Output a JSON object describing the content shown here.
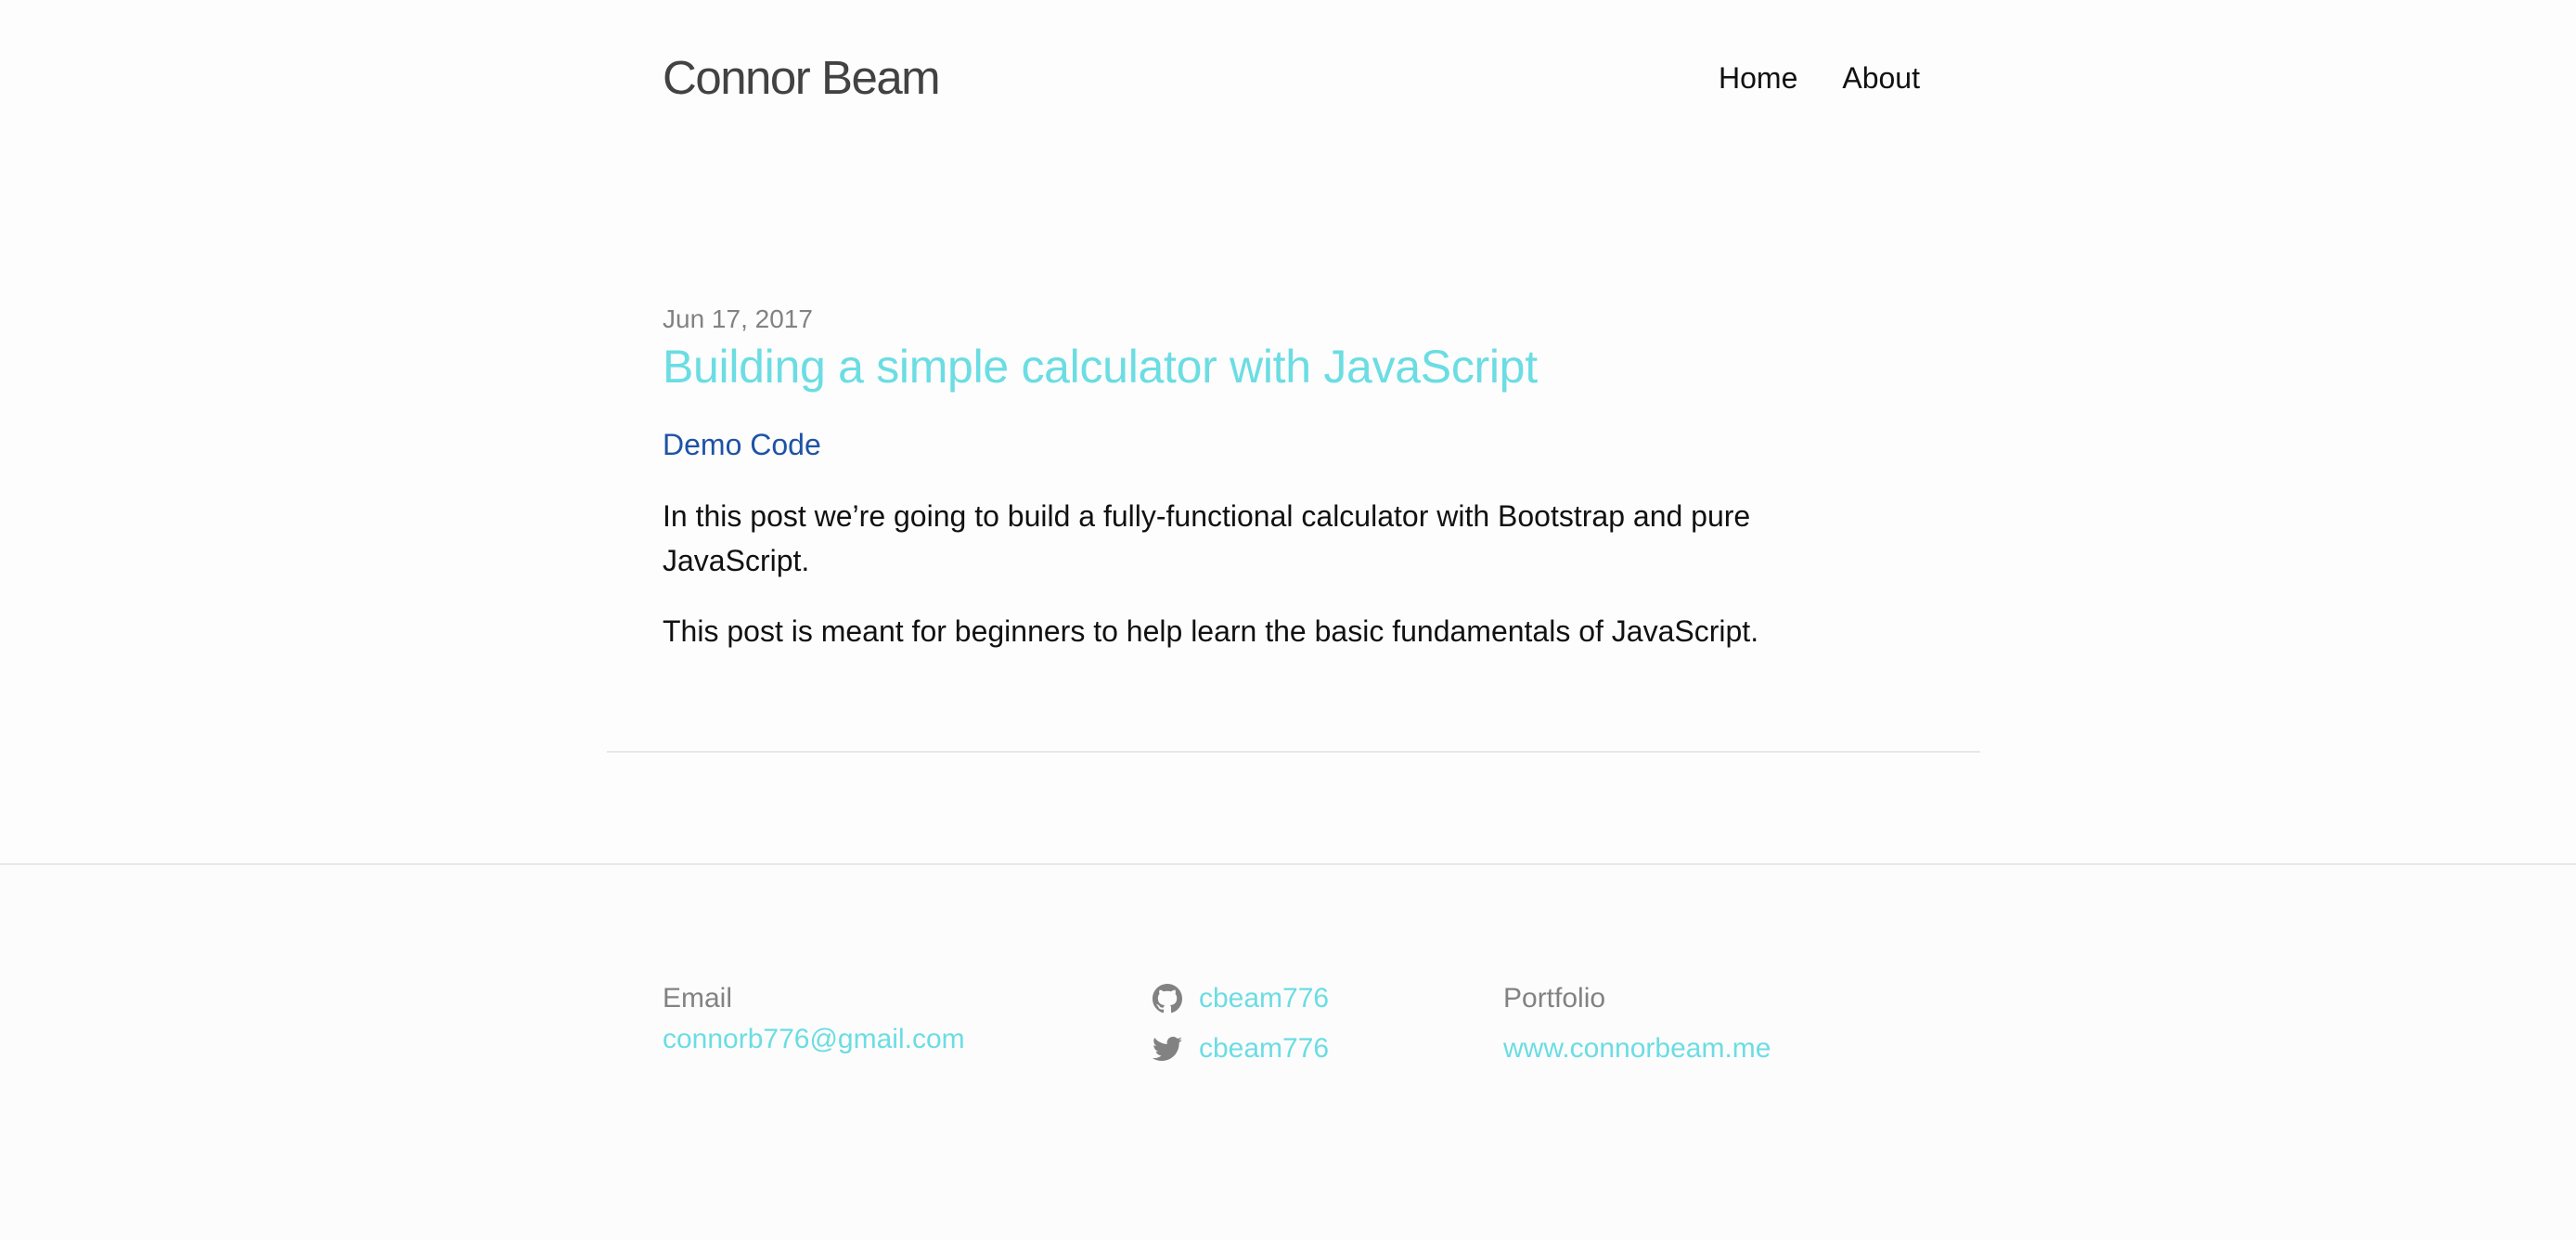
{
  "header": {
    "site_title": "Connor Beam",
    "nav": [
      {
        "label": "Home"
      },
      {
        "label": "About"
      }
    ]
  },
  "post": {
    "date": "Jun 17, 2017",
    "title": "Building a simple calculator with JavaScript",
    "demo_link": "Demo Code",
    "paragraphs": [
      "In this post we’re going to build a fully-functional calculator with Bootstrap and pure JavaScript.",
      "This post is meant for beginners to help learn the basic fundamentals of JavaScript."
    ]
  },
  "footer": {
    "email_label": "Email",
    "email_value": "connorb776@gmail.com",
    "github": {
      "icon": "github-icon",
      "handle": "cbeam776"
    },
    "twitter": {
      "icon": "twitter-icon",
      "handle": "cbeam776"
    },
    "portfolio_label": "Portfolio",
    "portfolio_value": "www.connorbeam.me"
  },
  "colors": {
    "accent": "#6bdde3",
    "link": "#1e53a6",
    "muted": "#828282",
    "background": "#fdfdfd"
  }
}
